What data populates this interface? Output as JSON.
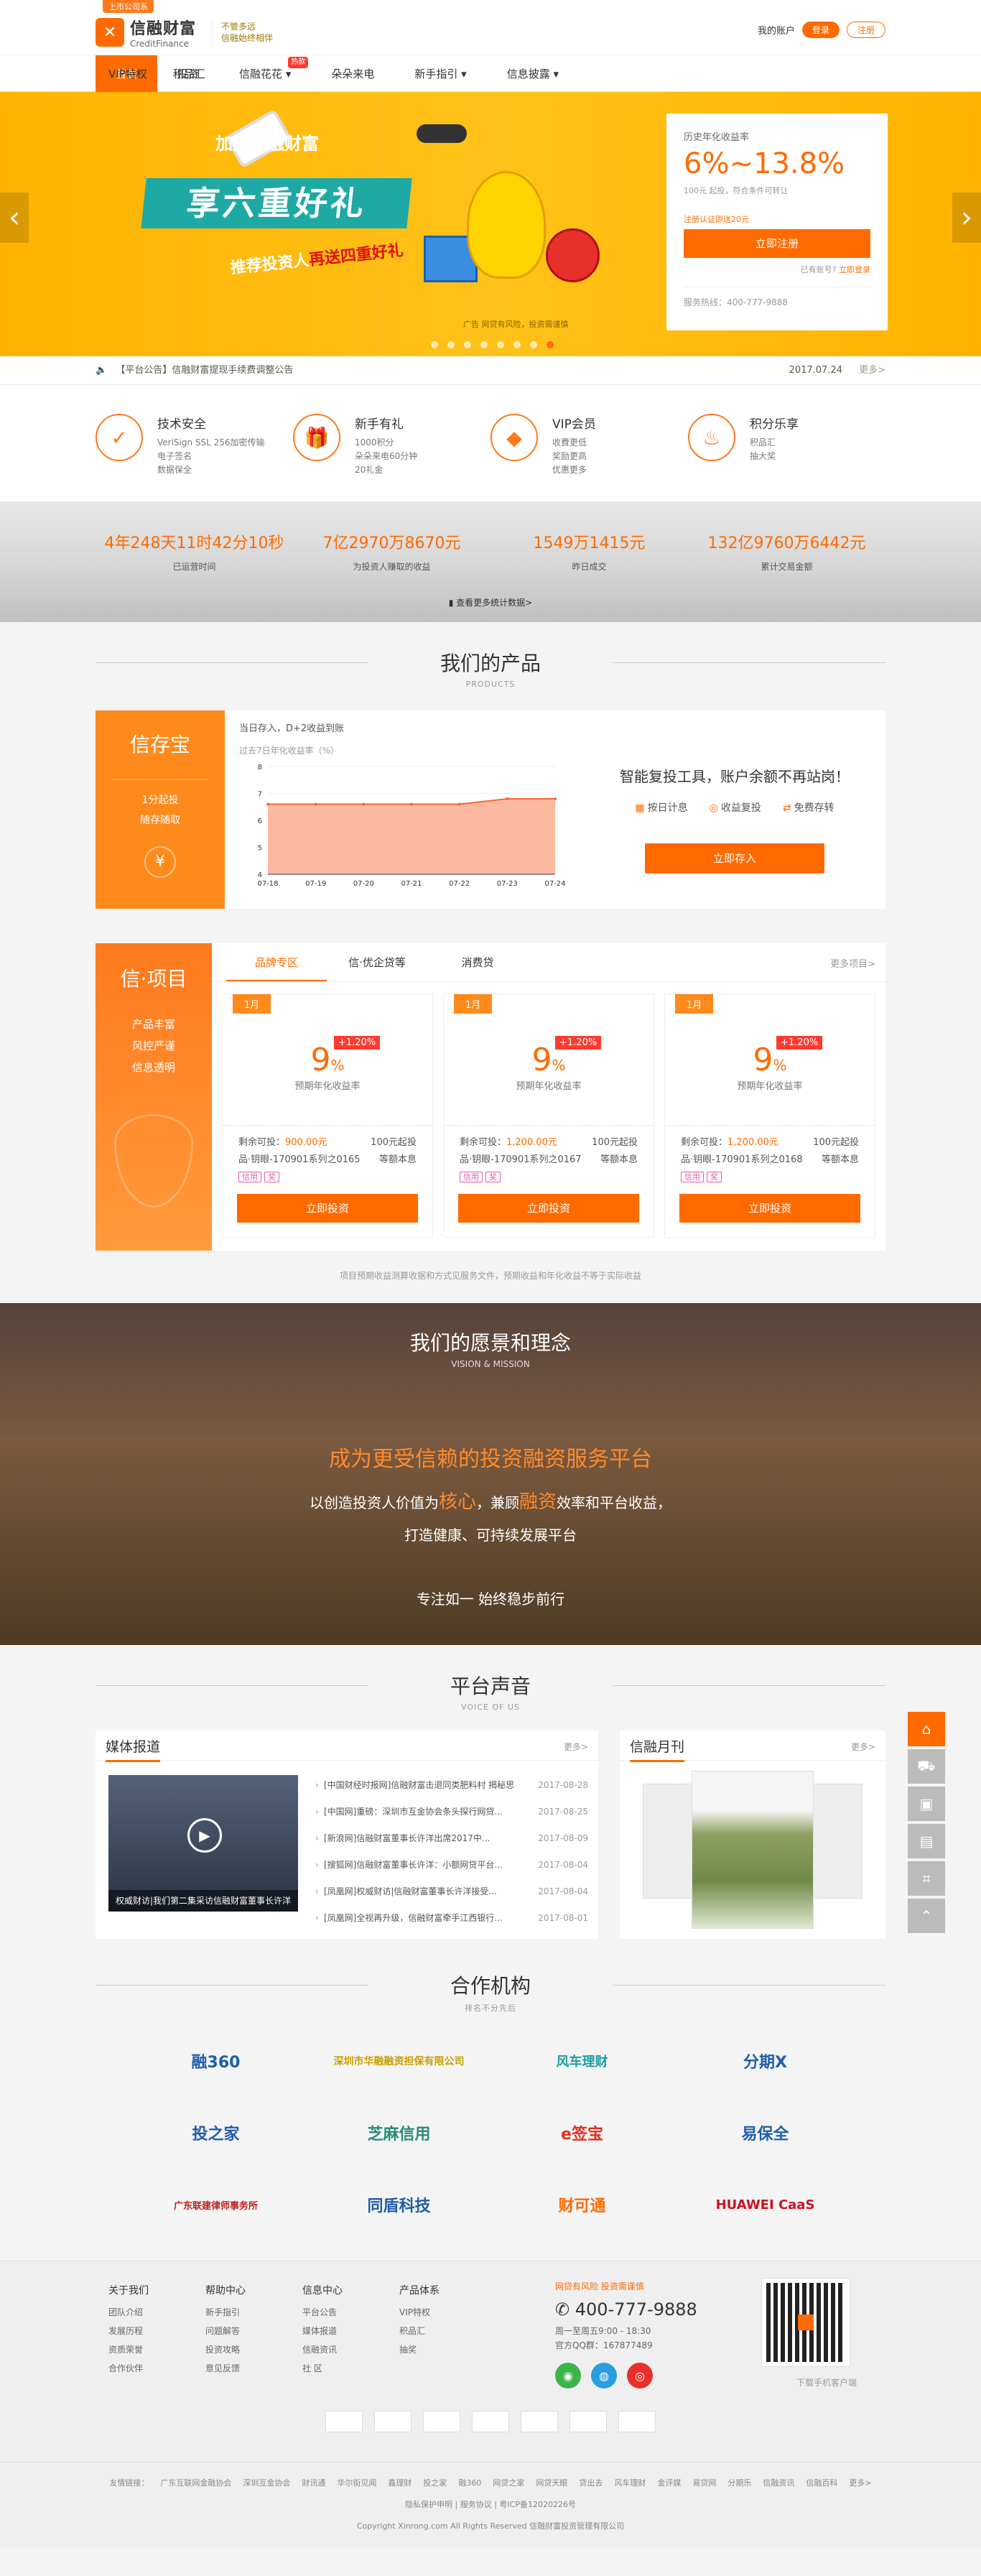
{
  "header": {
    "badge": "上市公司系",
    "brand_cn": "信融财富",
    "brand_en": "CreditFinance",
    "slogan1": "不管多远",
    "slogan2": "信融始终相伴",
    "account": "我的账户",
    "login": "登录",
    "register": "注册"
  },
  "nav": {
    "items": [
      "首页",
      "投资",
      "信融花花",
      "朵朵来电",
      "新手指引",
      "信息披露"
    ],
    "hot": "热款",
    "right": [
      "VIP特权",
      "积品汇"
    ]
  },
  "banner": {
    "sub": "加入信融财富",
    "headline": "享六重好礼",
    "line2_a": "推荐投资人",
    "line2_b": "再送四重好礼",
    "tag": "广告 网贷有风险，投资需谨慎",
    "promo": {
      "label": "历史年化收益率",
      "rate": "6%~13.8%",
      "note": "100元 起投，符合条件可转让",
      "note2": "注册认证即送20元",
      "btn": "立即注册",
      "have": "已有账号?",
      "login": "立即登录",
      "hotline": "服务热线：400-777-9888"
    }
  },
  "notice": {
    "text": "【平台公告】信融财富提现手续费调整公告",
    "date": "2017.07.24",
    "more": "更多>"
  },
  "features": [
    {
      "h": "技术安全",
      "d": [
        "VeriSign SSL 256加密传输",
        "电子签名",
        "数据保全"
      ]
    },
    {
      "h": "新手有礼",
      "d": [
        "1000积分",
        "朵朵来电60分钟",
        "20礼金"
      ]
    },
    {
      "h": "VIP会员",
      "d": [
        "收費更低",
        "奖励更高",
        "优惠更多"
      ]
    },
    {
      "h": "积分乐享",
      "d": [
        "积品汇",
        "抽大奖"
      ]
    }
  ],
  "stats": {
    "items": [
      {
        "v": "4年248天11时42分10秒",
        "l": "已运营时间"
      },
      {
        "v": "7亿2970万8670元",
        "l": "为投资人赚取的收益"
      },
      {
        "v": "1549万1415元",
        "l": "昨日成交"
      },
      {
        "v": "132亿9760万6442元",
        "l": "累计交易金额"
      }
    ],
    "more": "查看更多统计数据>"
  },
  "products": {
    "title": "我们的产品",
    "en": "PRODUCTS"
  },
  "cunbao": {
    "name": "信存宝",
    "s1": "1分起投",
    "s2": "随存随取",
    "a": "当日存入，D+2收益到账",
    "b": "过去7日年化收益率（%）",
    "q": "智能复投工具，账户余额不再站岗！",
    "ops": [
      "按日计息",
      "收益复投",
      "免费存转"
    ],
    "btn": "立即存入"
  },
  "chart_data": {
    "type": "area",
    "title": "过去7日年化收益率（%）",
    "ylim": [
      4,
      8
    ],
    "yticks": [
      "8",
      "7",
      "6",
      "5",
      "4"
    ],
    "x": [
      "07-18",
      "07-19",
      "07-20",
      "07-21",
      "07-22",
      "07-23",
      "07-24"
    ],
    "values": [
      6.6,
      6.6,
      6.6,
      6.6,
      6.6,
      6.8,
      6.8
    ]
  },
  "project": {
    "name": "信·项目",
    "s": [
      "产品丰富",
      "风控严谨",
      "信息透明"
    ],
    "tabs": [
      "品牌专区",
      "信·优企贷等",
      "消费贷"
    ],
    "more": "更多项目>",
    "cards": [
      {
        "lab": "1月",
        "rate": "9",
        "pct": "%",
        "plus": "+1.20%",
        "rl": "预期年化收益率",
        "remain": "剩余可投：",
        "amt": "900.00元",
        "min": "100元起投",
        "no": "品·钥眼-170901系列之0165",
        "pay": "等额本息"
      },
      {
        "lab": "1月",
        "rate": "9",
        "pct": "%",
        "plus": "+1.20%",
        "rl": "预期年化收益率",
        "remain": "剩余可投：",
        "amt": "1,200.00元",
        "min": "100元起投",
        "no": "品·钥眼-170901系列之0167",
        "pay": "等额本息"
      },
      {
        "lab": "1月",
        "rate": "9",
        "pct": "%",
        "plus": "+1.20%",
        "rl": "预期年化收益率",
        "remain": "剩余可投：",
        "amt": "1,200.00元",
        "min": "100元起投",
        "no": "品·钥眼-170901系列之0168",
        "pay": "等额本息"
      }
    ],
    "tag1": "信用",
    "tag2": "奖",
    "btn": "立即投资",
    "disc": "项目预期收益测算收据和方式见服务文件，预期收益和年化收益不等于实际收益"
  },
  "vision": {
    "cn": "我们的愿景和理念",
    "en": "VISION & MISSION",
    "l1": "成为更受信赖的投资融资服务平台",
    "l2a": "以创造投资人价值为",
    "l2b": "核心",
    "l2c": "，兼顾",
    "l2d": "融资",
    "l2e": "效率和平台收益，",
    "l3": "打造健康、可持续发展平台",
    "l4": "专注如一  始终稳步前行"
  },
  "voice": {
    "cn": "平台声音",
    "en": "VOICE OF US",
    "media": "媒体报道",
    "monthly": "信融月刊",
    "more": "更多>",
    "caption": "权威财访|我们第二集采访信融财富董事长许洋",
    "news": [
      {
        "t": "[中国财经时报网]信融财富击退同类肥料村 揭秘思",
        "d": "2017-08-28"
      },
      {
        "t": "[中国网]重磅：深圳市互金协会条头探行网贷...",
        "d": "2017-08-25"
      },
      {
        "t": "[新浪网]信融财富董事长许洋出席2017中...",
        "d": "2017-08-09"
      },
      {
        "t": "[搜狐网]信融财富董事长许洋：小额网贷平台...",
        "d": "2017-08-04"
      },
      {
        "t": "[凤凰网]权威财访|信融财富董事长许洋接受...",
        "d": "2017-08-04"
      },
      {
        "t": "[凤凰网]全视再升级，信融财富牵手江西银行...",
        "d": "2017-08-01"
      }
    ]
  },
  "partners": {
    "cn": "合作机构",
    "en": "排名不分先后",
    "items": [
      "融360",
      "深圳市华融融资担保有限公司",
      "风车理财",
      "分期X",
      "投之家",
      "芝麻信用",
      "e签宝",
      "易保全",
      "广东联建律师事务所",
      "同盾科技",
      "财可通",
      "HUAWEI CaaS"
    ]
  },
  "footer": {
    "cols": [
      {
        "h": "关于我们",
        "i": [
          "团队介绍",
          "发展历程",
          "资质荣誉",
          "合作伙伴"
        ]
      },
      {
        "h": "帮助中心",
        "i": [
          "新手指引",
          "问题解答",
          "投资攻略",
          "意见反馈"
        ]
      },
      {
        "h": "信息中心",
        "i": [
          "平台公告",
          "媒体报道",
          "信融资讯",
          "社 区"
        ]
      },
      {
        "h": "产品体系",
        "i": [
          "VIP特权",
          "积品汇",
          "抽奖"
        ]
      }
    ],
    "risk": "网贷有风险 投资需谨慎",
    "phone": "400-777-9888",
    "hours": "周一至周五9:00 - 18:30",
    "qq": "官方QQ群：167877489",
    "app": "下载手机客户端",
    "links": [
      "友情链接：",
      "广东互联网金融协会",
      "深圳互金协会",
      "财讯通",
      "华尔街见闻",
      "鑫理财",
      "投之家",
      "融360",
      "网贷之家",
      "网贷天眼",
      "贷出去",
      "风车理财",
      "金评媒",
      "易贷网",
      "分期乐",
      "信融资讯",
      "信融百科",
      "更多>"
    ],
    "legal": "隐私保护申明 | 服务协议 | 粤ICP备12020226号",
    "copy": "Copyright Xinrong.com All Rights Reserved 信融财富投资管理有限公司"
  }
}
